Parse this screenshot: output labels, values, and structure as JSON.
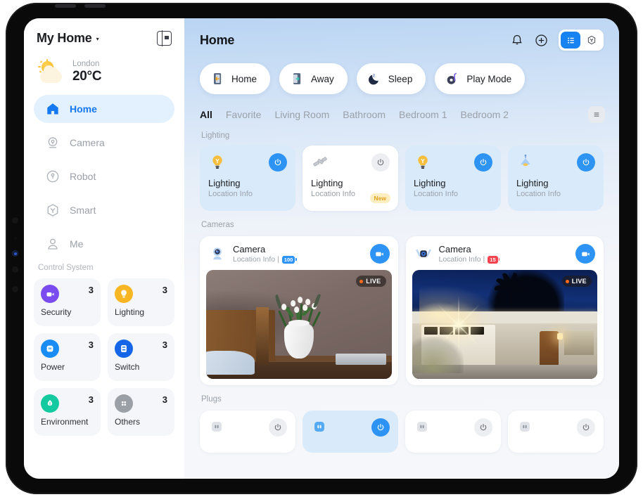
{
  "sidebar": {
    "home_title": "My Home",
    "caret": "▾",
    "collapse_icon": "sidebar-collapse-icon",
    "weather": {
      "city": "London",
      "temp": "20°C",
      "icon": "sun-behind-cloud-icon"
    },
    "nav": [
      {
        "label": "Home",
        "icon": "house-icon",
        "active": true
      },
      {
        "label": "Camera",
        "icon": "camera-icon",
        "active": false
      },
      {
        "label": "Robot",
        "icon": "robot-vacuum-icon",
        "active": false
      },
      {
        "label": "Smart",
        "icon": "cube-icon",
        "active": false
      },
      {
        "label": "Me",
        "icon": "person-icon",
        "active": false
      }
    ],
    "control_system_title": "Control System",
    "control_tiles": [
      {
        "name": "Security",
        "count": "3",
        "icon": "security-camera-icon",
        "color": "#7a4cf0"
      },
      {
        "name": "Lighting",
        "count": "3",
        "icon": "bulb-icon",
        "color": "#f8b625"
      },
      {
        "name": "Power",
        "count": "3",
        "icon": "outlet-icon",
        "color": "#1a8cf5"
      },
      {
        "name": "Switch",
        "count": "3",
        "icon": "switch-icon",
        "color": "#1565e8"
      },
      {
        "name": "Environment",
        "count": "3",
        "icon": "leaf-drop-icon",
        "color": "#12c9a0"
      },
      {
        "name": "Others",
        "count": "3",
        "icon": "grid-dots-icon",
        "color": "#9aa0a6"
      }
    ]
  },
  "header": {
    "title": "Home",
    "bell_icon": "notification-bell-icon",
    "add_icon": "add-circle-icon",
    "view_list_icon": "list-view-icon",
    "view_3d_icon": "cube-3d-view-icon"
  },
  "modes": [
    {
      "label": "Home",
      "icon": "door-enter-icon"
    },
    {
      "label": "Away",
      "icon": "door-exit-icon"
    },
    {
      "label": "Sleep",
      "icon": "moon-z-icon"
    },
    {
      "label": "Play Mode",
      "icon": "music-note-icon"
    }
  ],
  "tabs": [
    {
      "label": "All",
      "active": true
    },
    {
      "label": "Favorite",
      "active": false
    },
    {
      "label": "Living Room",
      "active": false
    },
    {
      "label": "Bathroom",
      "active": false
    },
    {
      "label": "Bedroom 1",
      "active": false
    },
    {
      "label": "Bedroom 2",
      "active": false
    }
  ],
  "filter_icon": "filter-list-icon",
  "sections": {
    "lighting_title": "Lighting",
    "cameras_title": "Cameras",
    "plugs_title": "Plugs"
  },
  "lights": [
    {
      "name": "Lighting",
      "sub": "Location Info",
      "on": true,
      "icon": "bulb-icon",
      "badge": ""
    },
    {
      "name": "Lighting",
      "sub": "Location Info",
      "on": false,
      "icon": "light-strip-icon",
      "badge": "New"
    },
    {
      "name": "Lighting",
      "sub": "Location Info",
      "on": true,
      "icon": "bulb-icon",
      "badge": ""
    },
    {
      "name": "Lighting",
      "sub": "Location Info",
      "on": true,
      "icon": "pendant-lamp-icon",
      "badge": ""
    }
  ],
  "cameras": [
    {
      "name": "Camera",
      "sub": "Location Info |",
      "battery": "100",
      "battery_level": "full",
      "live": "LIVE",
      "icon": "webcam-icon",
      "scene": "bedroom"
    },
    {
      "name": "Camera",
      "sub": "Location Info |",
      "battery": "15",
      "battery_level": "low",
      "live": "LIVE",
      "icon": "outdoor-camera-icon",
      "scene": "night-house"
    }
  ],
  "plugs": [
    {
      "on": false,
      "icon": "outlet-icon"
    },
    {
      "on": true,
      "icon": "outlet-icon"
    },
    {
      "on": false,
      "icon": "outlet-icon"
    },
    {
      "on": false,
      "icon": "outlet-icon"
    }
  ],
  "colors": {
    "accent_blue": "#1782f2",
    "active_card": "#d9eafb",
    "sidebar_active": "#e3f0fe",
    "live_orange": "#ff6a1a",
    "battery_low": "#f5444f"
  }
}
